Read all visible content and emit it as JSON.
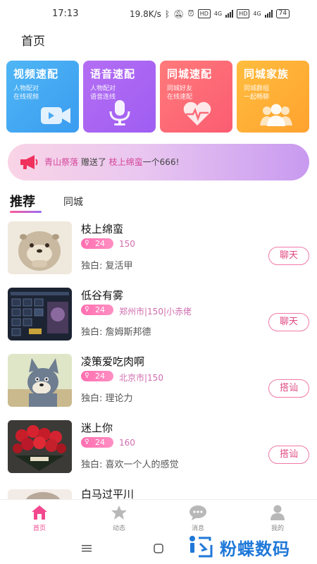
{
  "status_bar": {
    "time": "17:13",
    "speed": "19.8K/s",
    "net1": "4G",
    "net2": "4G",
    "hd": "HD",
    "battery": "74"
  },
  "header": {
    "title": "首页"
  },
  "cards": [
    {
      "title": "视频速配",
      "line1": "人物配对",
      "line2": "在线视频",
      "icon": "video-camera-icon"
    },
    {
      "title": "语音速配",
      "line1": "人物配对",
      "line2": "语音连线",
      "icon": "microphone-icon"
    },
    {
      "title": "同城速配",
      "line1": "同城好友",
      "line2": "在线速配",
      "icon": "heartbeat-icon"
    },
    {
      "title": "同城家族",
      "line1": "同城群组",
      "line2": "一起畅聊",
      "icon": "group-icon"
    }
  ],
  "notice": {
    "from": "青山祭落",
    "action": " 赠送了 ",
    "to": "枝上绵蛮",
    "gift": "一个666!"
  },
  "tabs": {
    "active": "推荐",
    "other": "同城"
  },
  "users": [
    {
      "name": "枝上绵蛮",
      "age": "24",
      "extra": "150",
      "monologue": "独白: 复活甲",
      "button": "聊天",
      "avatar": "otter-avatar"
    },
    {
      "name": "低谷有雾",
      "age": "24",
      "extra": "郑州市|150|小赤佬",
      "monologue": "独白: 詹姆斯邦德",
      "button": "聊天",
      "avatar": "game-screen-avatar"
    },
    {
      "name": "凌策爱吃肉啊",
      "age": "24",
      "extra": "北京市|150",
      "monologue": "独白: 理论力",
      "button": "搭讪",
      "avatar": "cartoon-cat-avatar"
    },
    {
      "name": "迷上你",
      "age": "24",
      "extra": "160",
      "monologue": "独白: 喜欢一个人的感觉",
      "button": "搭讪",
      "avatar": "roses-avatar"
    },
    {
      "name": "白马过平川",
      "age": "",
      "extra": "",
      "monologue": "",
      "button": "",
      "avatar": "partial-avatar"
    }
  ],
  "bottom_nav": [
    {
      "label": "首页",
      "icon": "home-icon",
      "active": true
    },
    {
      "label": "动态",
      "icon": "star-icon",
      "active": false
    },
    {
      "label": "消息",
      "icon": "chat-bubble-icon",
      "active": false
    },
    {
      "label": "我的",
      "icon": "person-icon",
      "active": false
    }
  ],
  "watermark": {
    "text": "粉蝶数码"
  },
  "colors": {
    "accent": "#f2488e",
    "badge": "#ff6fb0",
    "watermark": "#1f78d8"
  }
}
